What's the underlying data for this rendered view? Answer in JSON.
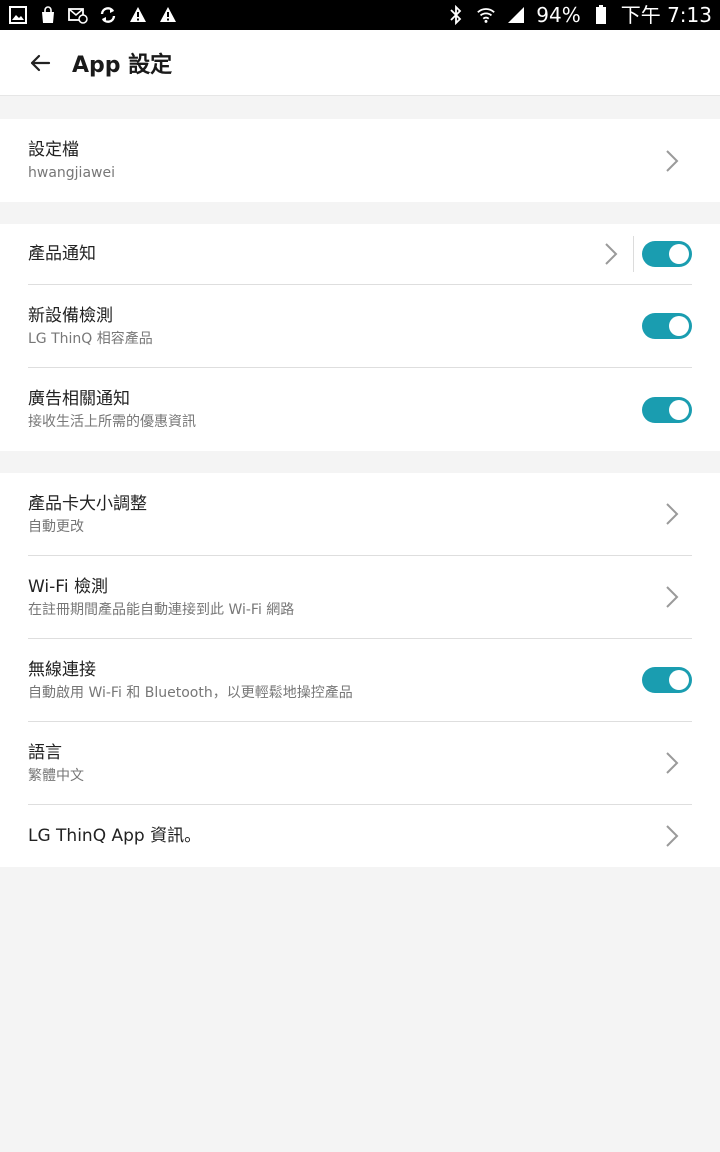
{
  "status_bar": {
    "battery": "94%",
    "time": "下午 7:13",
    "icons_left": [
      "gallery-icon",
      "bag-icon",
      "mail-icon",
      "sync-icon",
      "warning-icon",
      "warning-icon"
    ],
    "icons_right": [
      "bluetooth-icon",
      "wifi-icon",
      "signal-icon",
      "battery-icon"
    ]
  },
  "header": {
    "title": "App 設定"
  },
  "profile": {
    "title": "設定檔",
    "subtitle": "hwangjiawei"
  },
  "notifications": [
    {
      "title": "產品通知",
      "subtitle": "",
      "toggle": true,
      "chevron": true
    },
    {
      "title": "新設備檢測",
      "subtitle": "LG ThinQ 相容產品",
      "toggle": true
    },
    {
      "title": "廣告相關通知",
      "subtitle": "接收生活上所需的優惠資訊",
      "toggle": true
    }
  ],
  "general": [
    {
      "title": "產品卡大小調整",
      "subtitle": "自動更改",
      "type": "chevron"
    },
    {
      "title": "Wi-Fi 檢測",
      "subtitle": "在註冊期間產品能自動連接到此 Wi-Fi 網路",
      "type": "chevron"
    },
    {
      "title": "無線連接",
      "subtitle": "自動啟用 Wi-Fi 和 Bluetooth，以更輕鬆地操控產品",
      "type": "toggle",
      "on": true
    },
    {
      "title": "語言",
      "subtitle": "繁體中文",
      "type": "chevron"
    },
    {
      "title": "LG ThinQ App 資訊。",
      "subtitle": "",
      "type": "chevron"
    }
  ],
  "colors": {
    "accent": "#1a9db0",
    "background": "#f4f4f4"
  }
}
